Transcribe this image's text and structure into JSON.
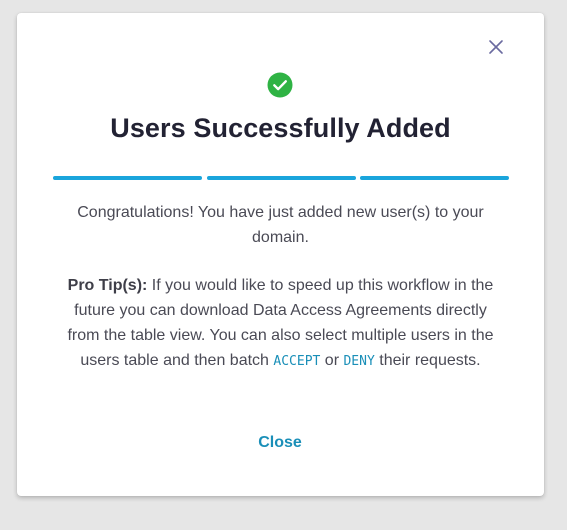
{
  "modal": {
    "title": "Users Successfully Added",
    "message": "Congratulations! You have just added new user(s) to your domain.",
    "tip": {
      "label": "Pro Tip(s):",
      "text_before_accept": " If you would like to speed up this workflow in the future you can download Data Access Agreements directly from the table view. You can also select multiple users in the users table and then batch ",
      "accept_keyword": "ACCEPT",
      "text_between": " or ",
      "deny_keyword": "DENY",
      "text_after_deny": " their requests."
    },
    "close_button_label": "Close",
    "progress_steps": 3,
    "icons": {
      "success": "check-circle-icon",
      "dismiss": "close-icon"
    }
  },
  "colors": {
    "accent": "#1aa5dc",
    "success": "#2fb344",
    "link": "#1a8fb8",
    "title": "#222233",
    "dismiss_icon": "#6a6aa0"
  }
}
